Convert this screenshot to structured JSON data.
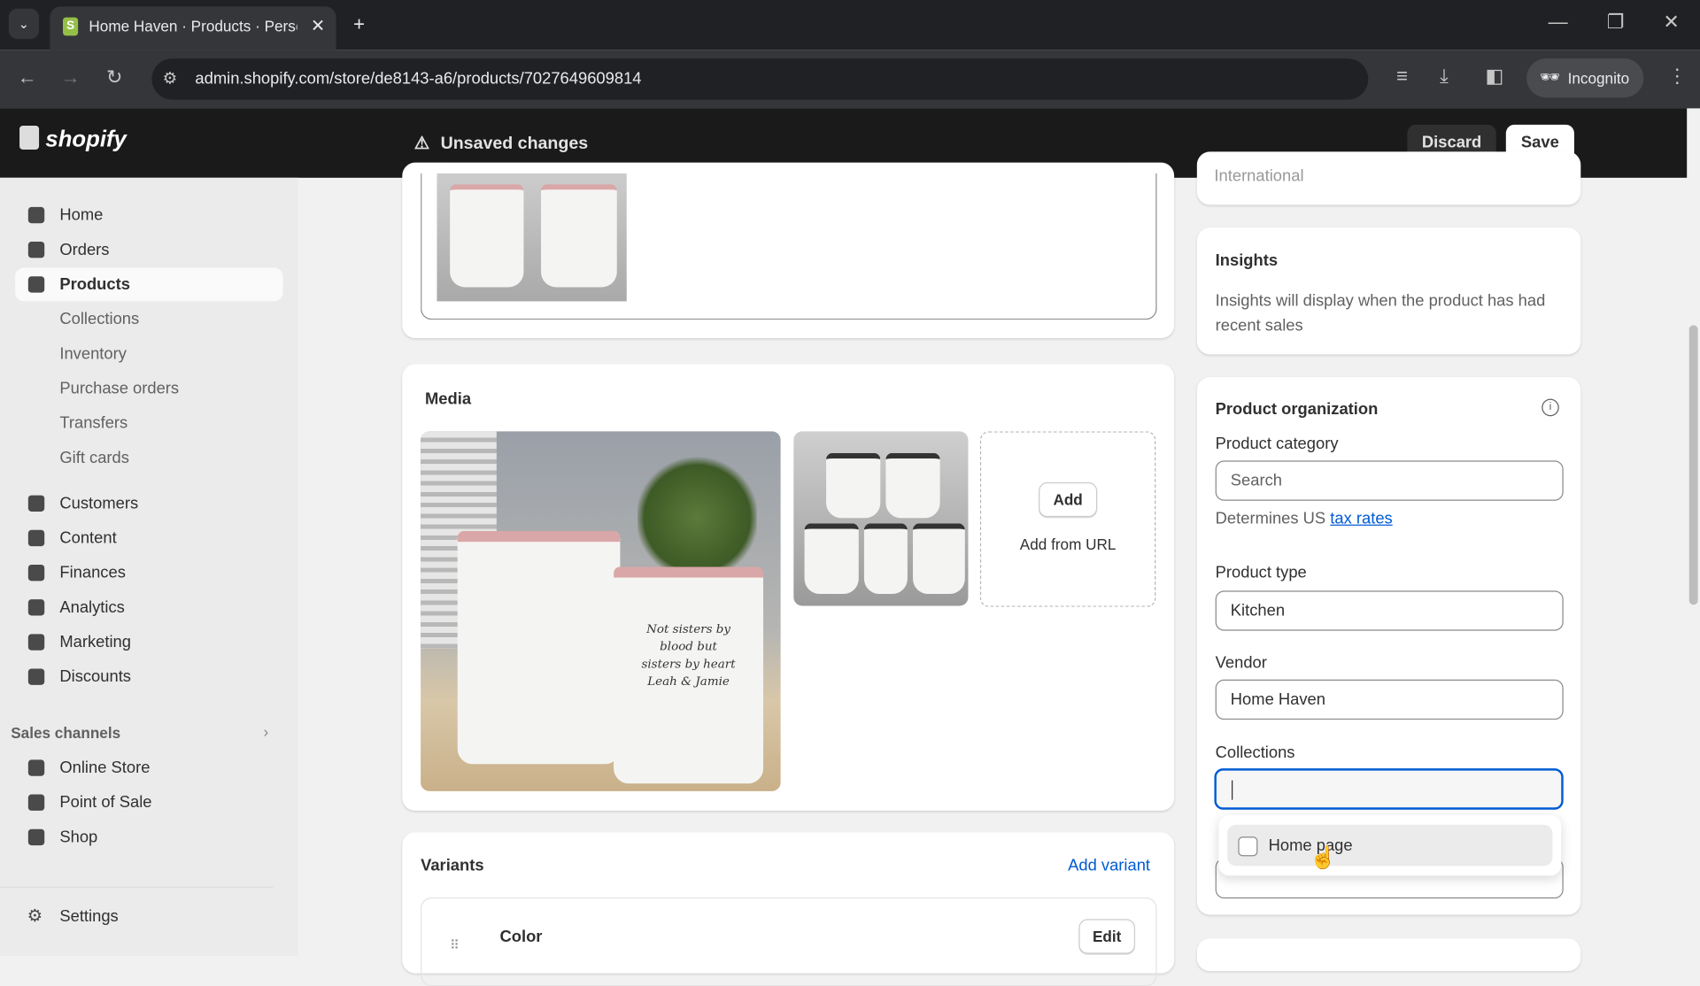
{
  "browser": {
    "tab_title": "Home Haven · Products · Perso",
    "url": "admin.shopify.com/store/de8143-a6/products/7027649609814",
    "incognito": "Incognito"
  },
  "topbar": {
    "logo": "shopify",
    "unsaved": "Unsaved changes",
    "discard": "Discard",
    "save": "Save"
  },
  "sidebar": {
    "items": [
      {
        "label": "Home",
        "icon": "home-icon"
      },
      {
        "label": "Orders",
        "icon": "inbox-icon"
      },
      {
        "label": "Products",
        "icon": "tag-icon",
        "active": true
      },
      {
        "label": "Collections"
      },
      {
        "label": "Inventory"
      },
      {
        "label": "Purchase orders"
      },
      {
        "label": "Transfers"
      },
      {
        "label": "Gift cards"
      },
      {
        "label": "Customers",
        "icon": "person-icon"
      },
      {
        "label": "Content",
        "icon": "content-icon"
      },
      {
        "label": "Finances",
        "icon": "bank-icon"
      },
      {
        "label": "Analytics",
        "icon": "bar-chart-icon"
      },
      {
        "label": "Marketing",
        "icon": "target-icon"
      },
      {
        "label": "Discounts",
        "icon": "discount-icon"
      }
    ],
    "sales_channels": "Sales channels",
    "channels": [
      {
        "label": "Online Store"
      },
      {
        "label": "Point of Sale"
      },
      {
        "label": "Shop"
      }
    ],
    "settings": "Settings"
  },
  "media": {
    "title": "Media",
    "add": "Add",
    "add_from_url": "Add from URL",
    "mug_text": "Not sisters by blood but sisters by heart Leah & Jamie"
  },
  "variants": {
    "title": "Variants",
    "add_variant": "Add variant",
    "option": "Color",
    "edit": "Edit"
  },
  "insights": {
    "partial_above": "International",
    "title": "Insights",
    "text": "Insights will display when the product has had recent sales"
  },
  "organization": {
    "title": "Product organization",
    "category_label": "Product category",
    "category_placeholder": "Search",
    "determines": "Determines US ",
    "tax_link": "tax rates",
    "type_label": "Product type",
    "type_value": "Kitchen",
    "vendor_label": "Vendor",
    "vendor_value": "Home Haven",
    "collections_label": "Collections",
    "collections_value": "",
    "dropdown": [
      {
        "label": "Home page",
        "checked": false
      }
    ]
  },
  "colors": {
    "accent": "#005bd3",
    "topbar": "#1a1a1a"
  }
}
